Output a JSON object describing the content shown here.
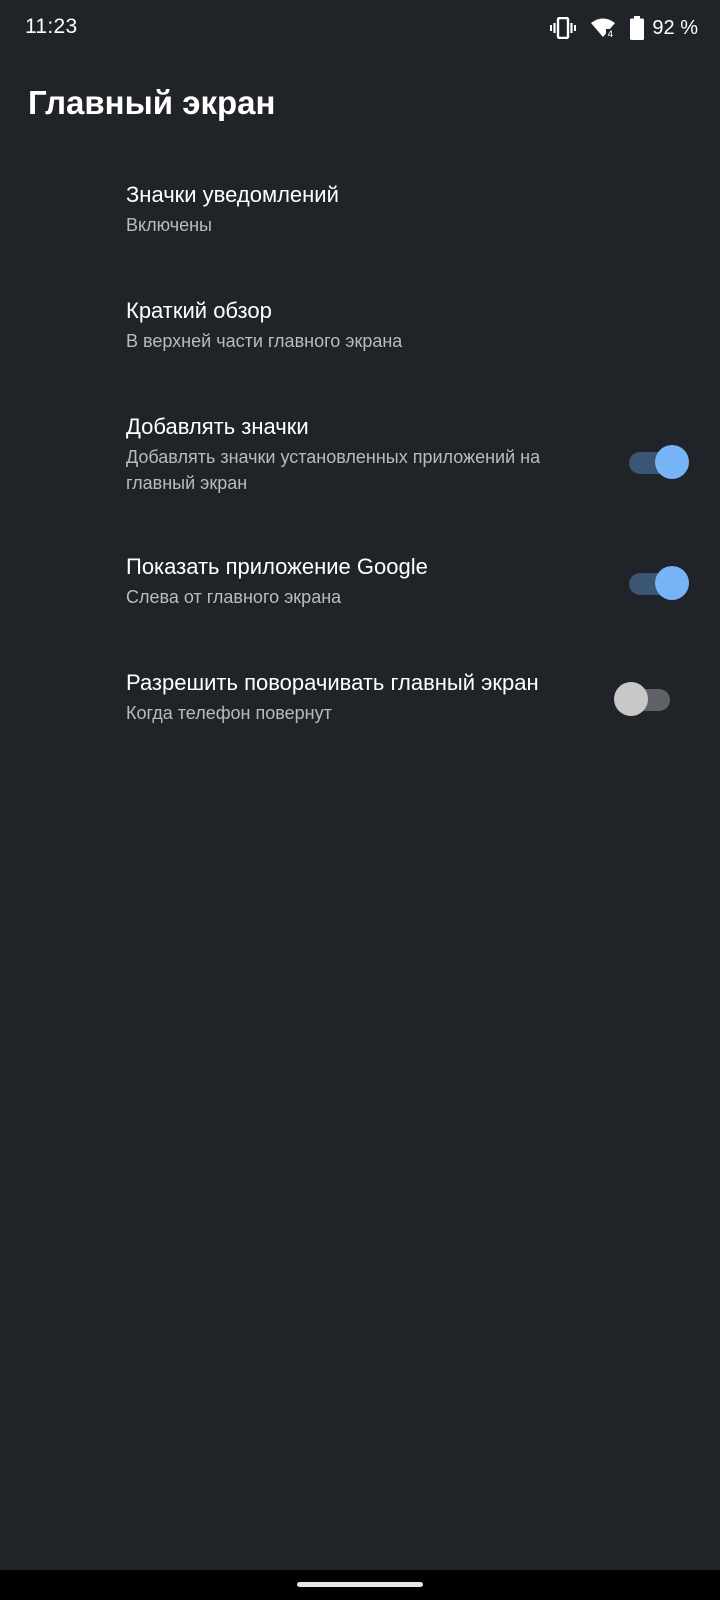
{
  "status_bar": {
    "time": "11:23",
    "battery_percent": "92 %",
    "icons": [
      "vibrate-icon",
      "wifi-icon",
      "battery-icon"
    ]
  },
  "header": {
    "title": "Главный экран"
  },
  "settings": [
    {
      "title": "Значки уведомлений",
      "summary": "Включены"
    },
    {
      "title": "Краткий обзор",
      "summary": "В верхней части главного экрана"
    },
    {
      "title": "Добавлять значки",
      "summary": "Добавлять значки установленных приложений на главный экран",
      "toggle": true
    },
    {
      "title": "Показать приложение Google",
      "summary": "Слева от главного экрана",
      "toggle": true
    },
    {
      "title": "Разрешить поворачивать главный экран",
      "summary": "Когда телефон повернут",
      "toggle": false
    }
  ],
  "colors": {
    "background": "#202428",
    "switch_on_thumb": "#77b3f7",
    "switch_on_track": "#3b5673",
    "switch_off_thumb": "#c8c8c8",
    "switch_off_track": "#5e6266"
  }
}
